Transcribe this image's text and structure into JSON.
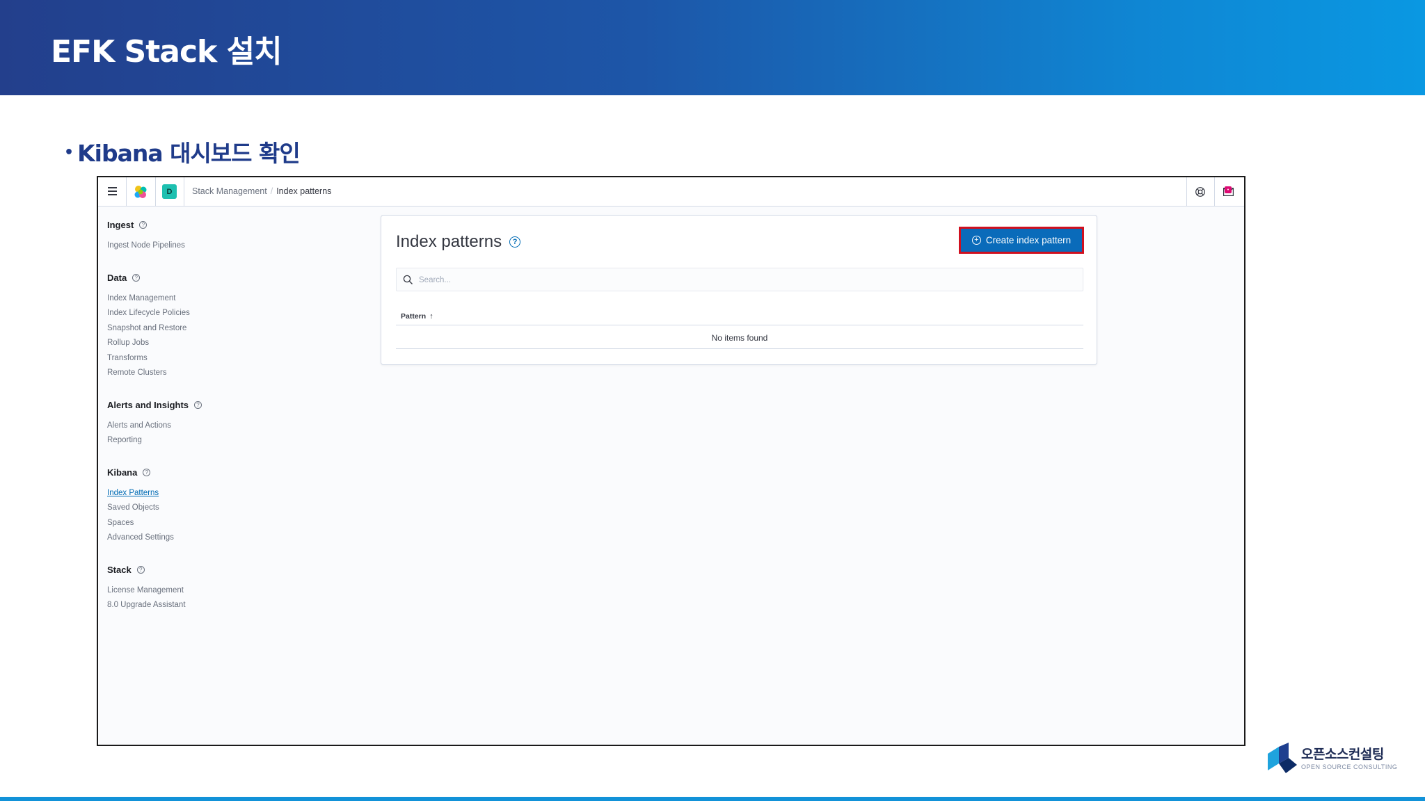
{
  "slide": {
    "title": "EFK Stack 설치",
    "bullet": "Kibana 대시보드 확인",
    "logo_korean": "오픈소스컨설팅",
    "logo_english": "OPEN SOURCE CONSULTING"
  },
  "kibana": {
    "header": {
      "space_initial": "D",
      "breadcrumb_parent": "Stack Management",
      "breadcrumb_separator": "/",
      "breadcrumb_current": "Index patterns",
      "news_badge": "•"
    },
    "sidenav": {
      "groups": [
        {
          "title": "Ingest",
          "items": [
            "Ingest Node Pipelines"
          ]
        },
        {
          "title": "Data",
          "items": [
            "Index Management",
            "Index Lifecycle Policies",
            "Snapshot and Restore",
            "Rollup Jobs",
            "Transforms",
            "Remote Clusters"
          ]
        },
        {
          "title": "Alerts and Insights",
          "items": [
            "Alerts and Actions",
            "Reporting"
          ]
        },
        {
          "title": "Kibana",
          "items": [
            "Index Patterns",
            "Saved Objects",
            "Spaces",
            "Advanced Settings"
          ]
        },
        {
          "title": "Stack",
          "items": [
            "License Management",
            "8.0 Upgrade Assistant"
          ]
        }
      ],
      "active_item": "Index Patterns"
    },
    "main": {
      "title": "Index patterns",
      "help_glyph": "?",
      "create_button_label": "Create index pattern",
      "search_placeholder": "Search...",
      "column_pattern": "Pattern",
      "sort_glyph": "↑",
      "empty_message": "No items found"
    },
    "colors": {
      "primary": "#006bb4",
      "highlight_border": "#d0101f",
      "header_gradient_start": "#233f8c",
      "header_gradient_end": "#0a98e2"
    }
  }
}
